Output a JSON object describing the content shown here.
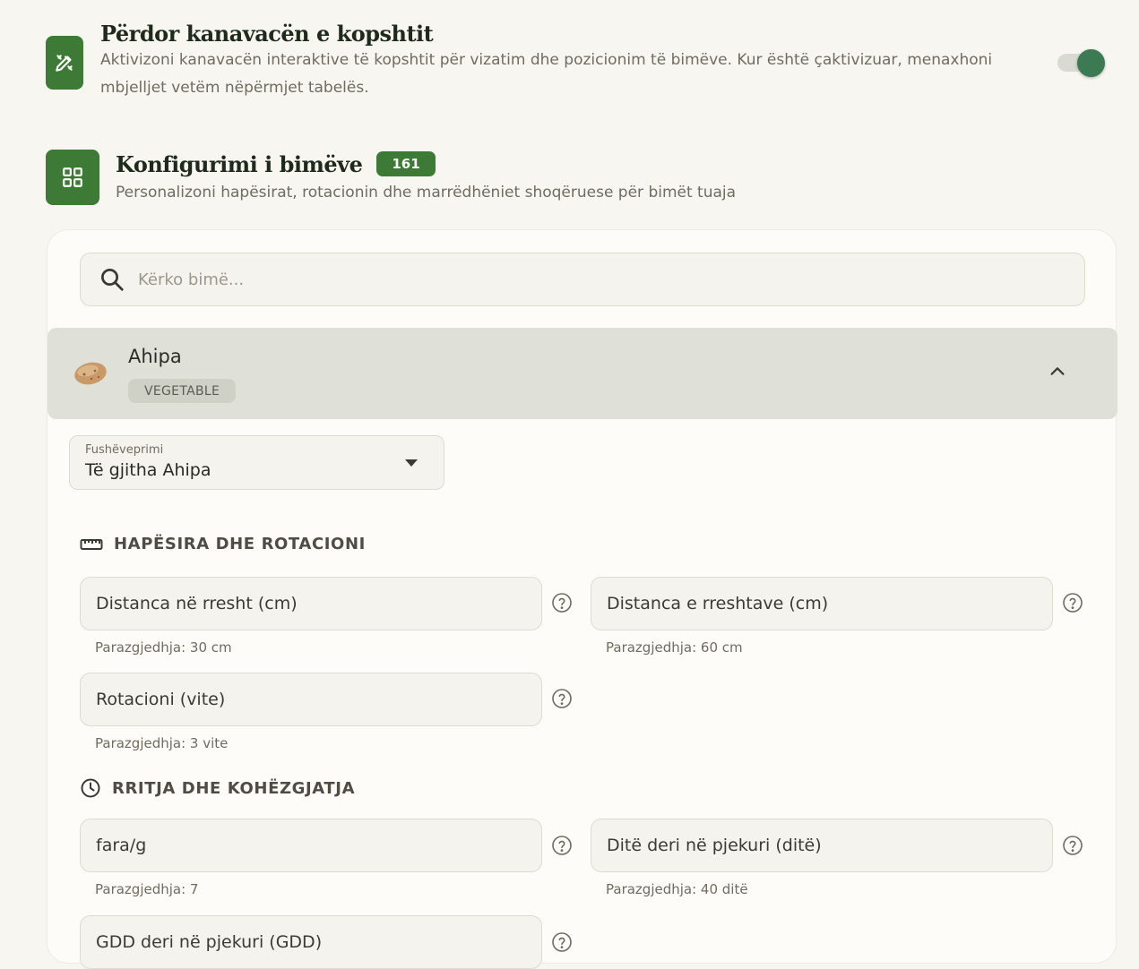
{
  "canvas_setting": {
    "title": "Përdor kanavacën e kopshtit",
    "description": "Aktivizoni kanavacën interaktive të kopshtit për vizatim dhe pozicionim të bimëve. Kur është çaktivizuar, menaxhoni mbjelljet vetëm nëpërmjet tabelës.",
    "enabled": true,
    "icon": "pencil-ruler-icon"
  },
  "plants_config": {
    "title": "Konfigurimi i bimëve",
    "count": "161",
    "description": "Personalizoni hapësirat, rotacionin dhe marrëdhëniet shoqëruese për bimët tuaja",
    "icon": "grid-icon"
  },
  "search": {
    "placeholder": "Kërko bimë...",
    "value": ""
  },
  "plant": {
    "name": "Ahipa",
    "type": "VEGETABLE",
    "expanded": true
  },
  "scope_select": {
    "label": "Fushëveprimi",
    "value": "Të gjitha Ahipa"
  },
  "groups": {
    "spacing": {
      "title": "HAPËSIRA DHE ROTACIONI",
      "fields": [
        {
          "label": "Distanca në rresht (cm)",
          "hint": "Parazgjedhja: 30 cm"
        },
        {
          "label": "Distanca e rreshtave (cm)",
          "hint": "Parazgjedhja: 60 cm"
        },
        {
          "label": "Rotacioni (vite)",
          "hint": "Parazgjedhja: 3 vite"
        }
      ]
    },
    "growth": {
      "title": "RRITJA DHE KOHËZGJATJA",
      "fields": [
        {
          "label": "fara/g",
          "hint": "Parazgjedhja: 7"
        },
        {
          "label": "Ditë deri në pjekuri (ditë)",
          "hint": "Parazgjedhja: 40 ditë"
        },
        {
          "label": "GDD deri në pjekuri (GDD)",
          "hint": ""
        }
      ]
    }
  },
  "colors": {
    "accent_green": "#3d7a35",
    "toggle_knob": "#3b7a52",
    "background": "#f7f6f1"
  }
}
